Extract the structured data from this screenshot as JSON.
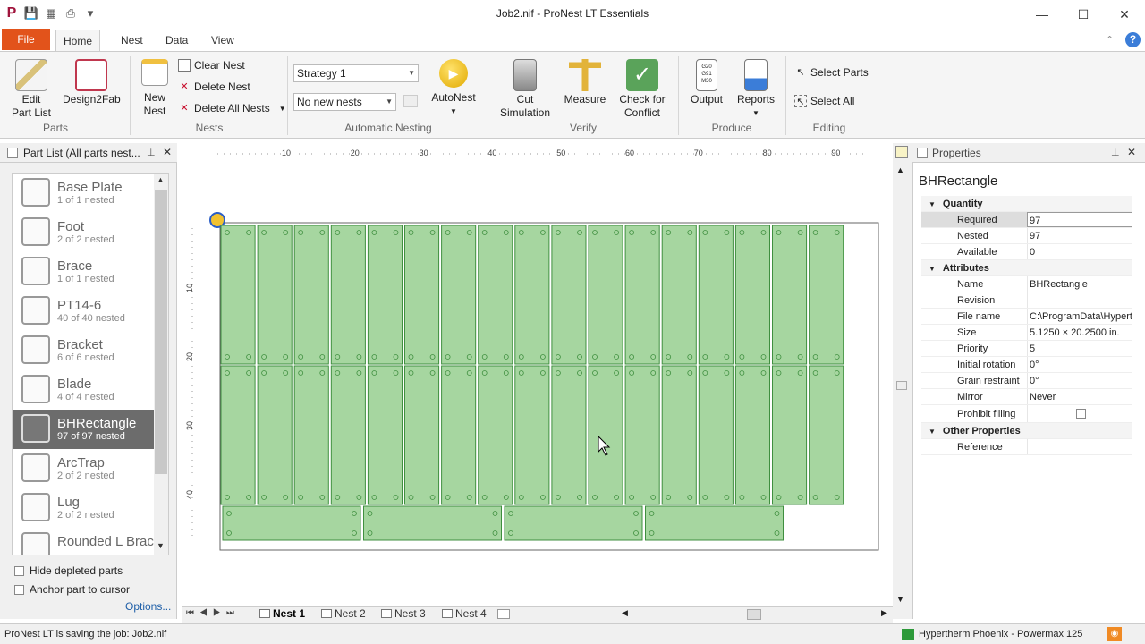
{
  "window": {
    "title": "Job2.nif - ProNest LT Essentials",
    "app_logo": "P"
  },
  "tabs": {
    "file": "File",
    "home": "Home",
    "nest": "Nest",
    "data": "Data",
    "view": "View"
  },
  "ribbon": {
    "parts": {
      "edit_part_list": "Edit\nPart List",
      "design2fab": "Design2Fab",
      "label": "Parts"
    },
    "nests": {
      "new_nest": "New\nNest",
      "clear_nest": "Clear Nest",
      "delete_nest": "Delete Nest",
      "delete_all_nests": "Delete All Nests",
      "label": "Nests"
    },
    "auto": {
      "strategy": "Strategy 1",
      "new_nests": "No new nests",
      "autonest": "AutoNest",
      "label": "Automatic Nesting"
    },
    "verify": {
      "cut_simulation": "Cut\nSimulation",
      "measure": "Measure",
      "check_conflict": "Check for\nConflict",
      "label": "Verify"
    },
    "produce": {
      "output": "Output",
      "reports": "Reports",
      "label": "Produce"
    },
    "editing": {
      "select_parts": "Select Parts",
      "select_all": "Select All",
      "label": "Editing"
    }
  },
  "part_list": {
    "title": "Part List  (All parts nest...",
    "items": [
      {
        "name": "Base Plate",
        "status": "1 of 1 nested"
      },
      {
        "name": "Foot",
        "status": "2 of 2 nested"
      },
      {
        "name": "Brace",
        "status": "1 of 1 nested"
      },
      {
        "name": "PT14-6",
        "status": "40 of 40 nested"
      },
      {
        "name": "Bracket",
        "status": "6 of 6 nested"
      },
      {
        "name": "Blade",
        "status": "4 of 4 nested"
      },
      {
        "name": "BHRectangle",
        "status": "97 of 97 nested"
      },
      {
        "name": "ArcTrap",
        "status": "2 of 2 nested"
      },
      {
        "name": "Lug",
        "status": "2 of 2 nested"
      },
      {
        "name": "Rounded L Brac",
        "status": ""
      }
    ],
    "selected_index": 6,
    "hide_depleted": "Hide depleted parts",
    "anchor_part": "Anchor part to cursor",
    "options": "Options..."
  },
  "ruler": {
    "top": [
      "10",
      "20",
      "30",
      "40",
      "50",
      "60",
      "70",
      "80",
      "90"
    ],
    "left": [
      "10",
      "20",
      "30",
      "40"
    ]
  },
  "nest_tabs": [
    {
      "label": "Nest 1",
      "active": true
    },
    {
      "label": "Nest 2",
      "active": false
    },
    {
      "label": "Nest 3",
      "active": false
    },
    {
      "label": "Nest 4",
      "active": false
    }
  ],
  "properties": {
    "title": "Properties",
    "part_name": "BHRectangle",
    "cat_quantity": "Quantity",
    "required_k": "Required",
    "required_v": "97",
    "nested_k": "Nested",
    "nested_v": "97",
    "available_k": "Available",
    "available_v": "0",
    "cat_attributes": "Attributes",
    "name_k": "Name",
    "name_v": "BHRectangle",
    "revision_k": "Revision",
    "revision_v": "",
    "filename_k": "File name",
    "filename_v": "C:\\ProgramData\\Hypert",
    "size_k": "Size",
    "size_v": "5.1250 × 20.2500 in.",
    "priority_k": "Priority",
    "priority_v": "5",
    "initrot_k": "Initial rotation",
    "initrot_v": "0°",
    "grain_k": "Grain restraint",
    "grain_v": "0°",
    "mirror_k": "Mirror",
    "mirror_v": "Never",
    "prohibit_k": "Prohibit filling",
    "cat_other": "Other Properties",
    "reference_k": "Reference",
    "reference_v": ""
  },
  "status": {
    "left": "ProNest LT is saving the job: Job2.nif",
    "machine": "Hypertherm Phoenix - Powermax 125"
  },
  "colors": {
    "file_tab": "#e2531b",
    "part_fill": "#a6d6a0",
    "part_stroke": "#3f8f3f",
    "selected_row": "#6c6c6c"
  }
}
